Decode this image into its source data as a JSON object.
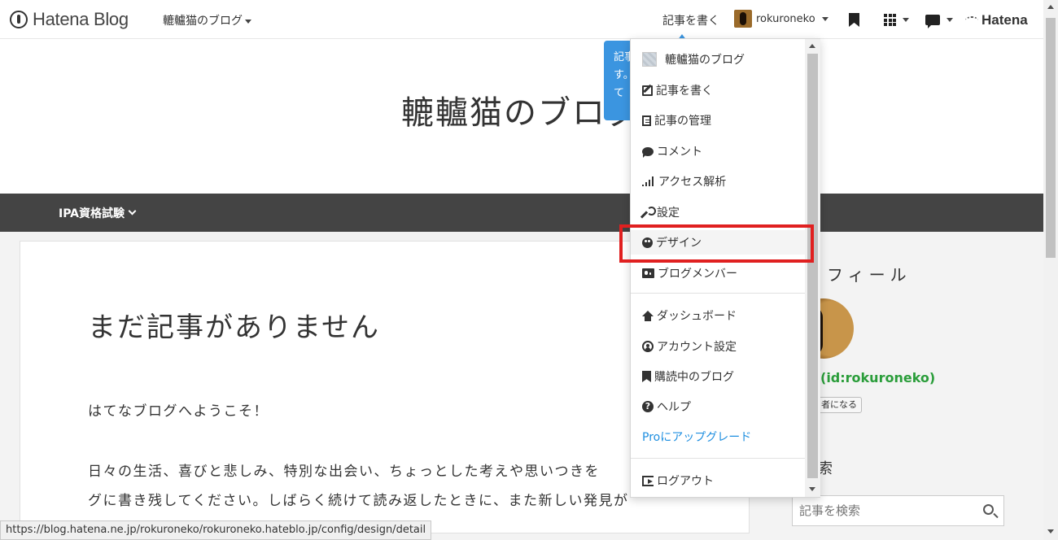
{
  "topbar": {
    "logo_text": "Hatena Blog",
    "blog_select_label": "轆轤猫のブログ",
    "write_label": "記事を書く",
    "username": "rokuroneko",
    "brand": "Hatena"
  },
  "header": {
    "blog_title": "轆轤猫のブログ"
  },
  "nav": {
    "category_label": "IPA資格試験"
  },
  "main": {
    "no_posts_heading": "まだ記事がありません",
    "welcome": "はてなブログへようこそ！",
    "body_line1": "日々の生活、喜びと悲しみ、特別な出会い、ちょっとした考えや思いつきを",
    "body_line2": "グに書き残してください。しばらく続けて読み返したときに、また新しい発見が"
  },
  "tooltip": {
    "lines": [
      "記事",
      "す。",
      "て"
    ]
  },
  "dropdown": {
    "items": [
      {
        "label": "轆轤猫のブログ",
        "icon": "blog-thumbnail-icon"
      },
      {
        "label": "記事を書く",
        "icon": "edit-icon"
      },
      {
        "label": "記事の管理",
        "icon": "document-icon"
      },
      {
        "label": "コメント",
        "icon": "comment-icon"
      },
      {
        "label": "アクセス解析",
        "icon": "signal-bars-icon"
      },
      {
        "label": "設定",
        "icon": "wrench-icon"
      },
      {
        "label": "デザイン",
        "icon": "palette-icon"
      },
      {
        "label": "ブログメンバー",
        "icon": "members-icon"
      },
      {
        "label": "ダッシュボード",
        "icon": "home-icon"
      },
      {
        "label": "アカウント設定",
        "icon": "user-circle-icon"
      },
      {
        "label": "購読中のブログ",
        "icon": "bookmark-icon"
      },
      {
        "label": "ヘルプ",
        "icon": "help-icon"
      },
      {
        "label": "Proにアップグレード",
        "icon": ""
      },
      {
        "label": "ログアウト",
        "icon": "logout-icon"
      }
    ],
    "selected": "デザイン"
  },
  "sidebar": {
    "profile_heading": "ロフィール",
    "profile_id": "(id:rokuroneko)",
    "reader_button": "者になる",
    "search_heading": "索",
    "search_placeholder": "記事を検索"
  },
  "statusbar": {
    "url": "https://blog.hatena.ne.jp/rokuroneko/rokuroneko.hateblo.jp/config/design/detail"
  },
  "colors": {
    "navbar": "#444444",
    "accent_blue": "#3b95e0",
    "pro_link": "#1f8fe0",
    "highlight_red": "#e02020",
    "profile_green": "#2a9d3a"
  }
}
